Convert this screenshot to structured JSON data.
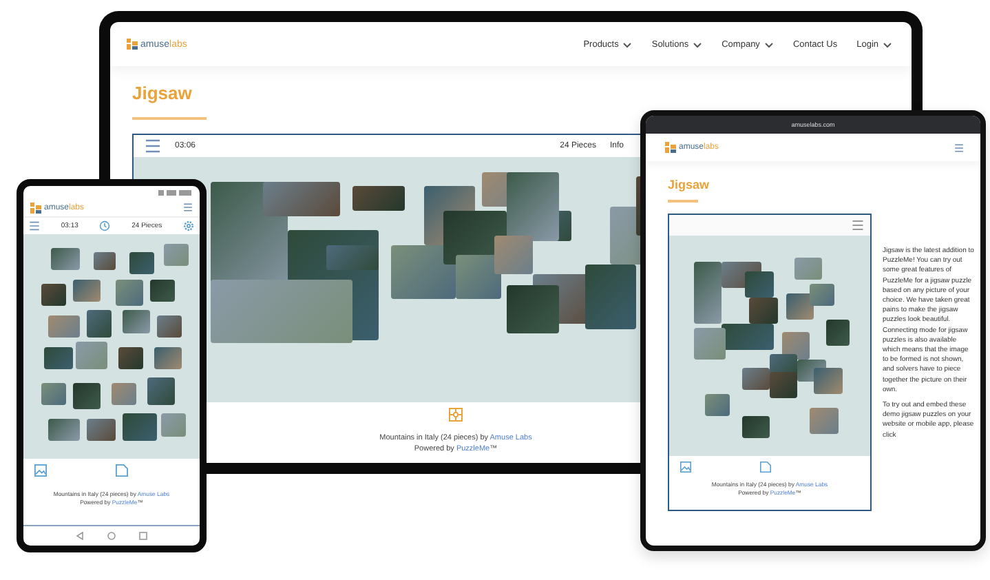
{
  "laptop": {
    "logo": {
      "part1": "amuse",
      "part2": "labs"
    },
    "nav": [
      {
        "label": "Products",
        "dropdown": true
      },
      {
        "label": "Solutions",
        "dropdown": true
      },
      {
        "label": "Company",
        "dropdown": true
      },
      {
        "label": "Contact Us",
        "dropdown": false
      },
      {
        "label": "Login",
        "dropdown": true
      }
    ],
    "title": "Jigsaw",
    "toolbar": {
      "timer": "03:06",
      "pieces": "24 Pieces",
      "info": "Info"
    },
    "caption": {
      "text": "Mountains in Italy (24 pieces) by ",
      "link": "Amuse Labs",
      "powered": "Powered by ",
      "powered_link": "PuzzleMe",
      "suffix": "™"
    }
  },
  "phone": {
    "logo": {
      "part1": "amuse",
      "part2": "labs"
    },
    "toolbar": {
      "timer": "03:13",
      "pieces": "24 Pieces"
    },
    "caption": {
      "text": "Mountains in Italy (24 pieces) by ",
      "link": "Amuse Labs",
      "powered": "Powered by ",
      "powered_link": "PuzzleMe",
      "suffix": "™"
    }
  },
  "tablet": {
    "url": "amuselabs.com",
    "logo": {
      "part1": "amuse",
      "part2": "labs"
    },
    "title": "Jigsaw",
    "caption": {
      "text": "Mountains in Italy (24 pieces) by ",
      "link": "Amuse Labs",
      "powered": "Powered by ",
      "powered_link": "PuzzleMe",
      "suffix": "™"
    },
    "paragraphs": [
      "Jigsaw is the latest addition to PuzzleMe! You can try out some great features of PuzzleMe for a jigsaw puzzle based on any picture of your choice. We have taken great pains to make the jigsaw puzzles look beautiful. Connecting mode for jigsaw puzzles is also available which means that the image to be formed is not shown, and solvers have to piece together the picture on their own.",
      "To try out and embed these demo jigsaw puzzles on your website or mobile app, please click"
    ]
  }
}
